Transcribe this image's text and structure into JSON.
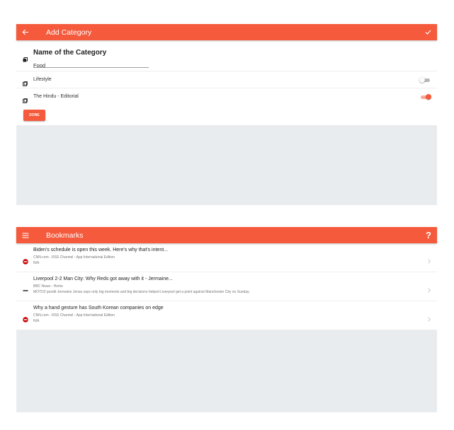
{
  "add_category": {
    "title": "Add Category",
    "field_label": "Name of the Category",
    "field_value": "Food",
    "feeds": [
      {
        "label": "Lifestyle",
        "enabled": false
      },
      {
        "label": "The Hindu - Editorial",
        "enabled": true
      }
    ],
    "done_label": "DONE"
  },
  "bookmarks": {
    "title": "Bookmarks",
    "help_label": "?",
    "items": [
      {
        "title": "Biden's schedule is open this week. Here's why that's intent...",
        "source": "CNN.com - RSS Channel - App International Edition",
        "description": "N/A",
        "icon": "cnn-logo"
      },
      {
        "title": "Liverpool 2-2 Man City: Why Reds got away with it - Jermaine...",
        "source": "BBC News - Home",
        "description": "MOTD2 pundit Jermaine Jenas says only big moments and big decisions helped Liverpool get a point against Manchester City on Sunday.",
        "icon": "bbc-logo"
      },
      {
        "title": "Why a hand gesture has South Korean companies on edge",
        "source": "CNN.com - RSS Channel - App International Edition",
        "description": "N/A",
        "icon": "cnn-logo"
      }
    ]
  },
  "colors": {
    "accent": "#f55a3c",
    "gray_area": "#e9ecef"
  }
}
